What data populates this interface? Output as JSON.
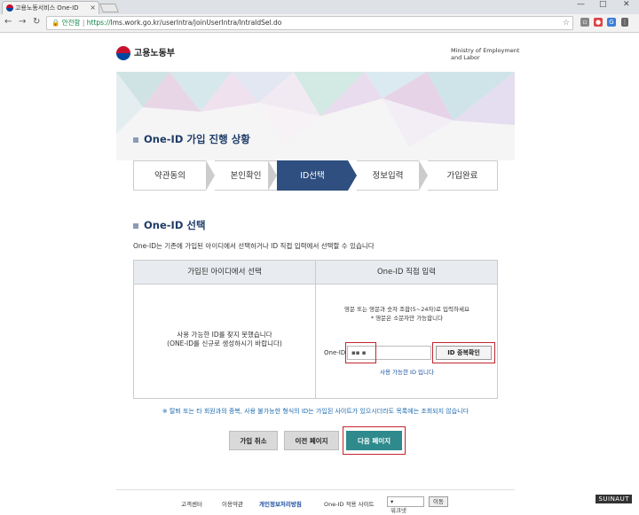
{
  "browser": {
    "tab_title": "고용노동서비스 One-ID",
    "tab_close": "×",
    "secure_label": "안전함",
    "url_prefix": "https://",
    "url_rest": "lms.work.go.kr/userIntra/joinUserIntra/IntraIdSel.do",
    "window_controls": [
      "—",
      "□",
      "✕"
    ]
  },
  "header": {
    "logo_text": "고용노동부",
    "ministry_line1": "Ministry of Employment",
    "ministry_line2": "and Labor"
  },
  "progress": {
    "title": "One-ID 가입 진행 상황",
    "steps": [
      "약관동의",
      "본인확인",
      "ID선택",
      "정보입력",
      "가입완료"
    ],
    "active_step": 2
  },
  "select": {
    "title": "One-ID 선택",
    "description": "One-ID는 기존에 가입된 아이디에서 선택하거나 ID 직접 입력에서 선택할 수 있습니다",
    "left_header": "가입된 아이디에서 선택",
    "right_header": "One-ID 직접 입력",
    "left_msg_line1": "사용 가능한 ID를 찾지 못했습니다",
    "left_msg_line2": "(ONE-ID를 신규로 생성하시기 바랍니다)",
    "right_msg_line1": "영문 또는 영문과 숫자 조합(5~24자)로 입력하세요",
    "right_msg_line2": "* 영문은 소문자만 가능합니다",
    "id_label": "One-ID",
    "id_value": "▪▪ ▪",
    "dup_button": "ID 중복확인",
    "available_msg": "사용 가능한 ID 입니다"
  },
  "notice": "※ 탈퇴 또는 타 회원과의 중복, 사용 불가능한 형식의 ID는 가입된 사이트가 있으시더라도 목록에는 조회되지 않습니다",
  "buttons": {
    "cancel": "가입 취소",
    "prev": "이전 페이지",
    "next": "다음 페이지"
  },
  "footer": {
    "customer": "고객센터",
    "terms": "이용약관",
    "privacy": "개인정보처리방침",
    "related": "One-ID 적용 사이트",
    "select_value": "워크넷",
    "go": "이동"
  },
  "watermark": "SUINAUT"
}
